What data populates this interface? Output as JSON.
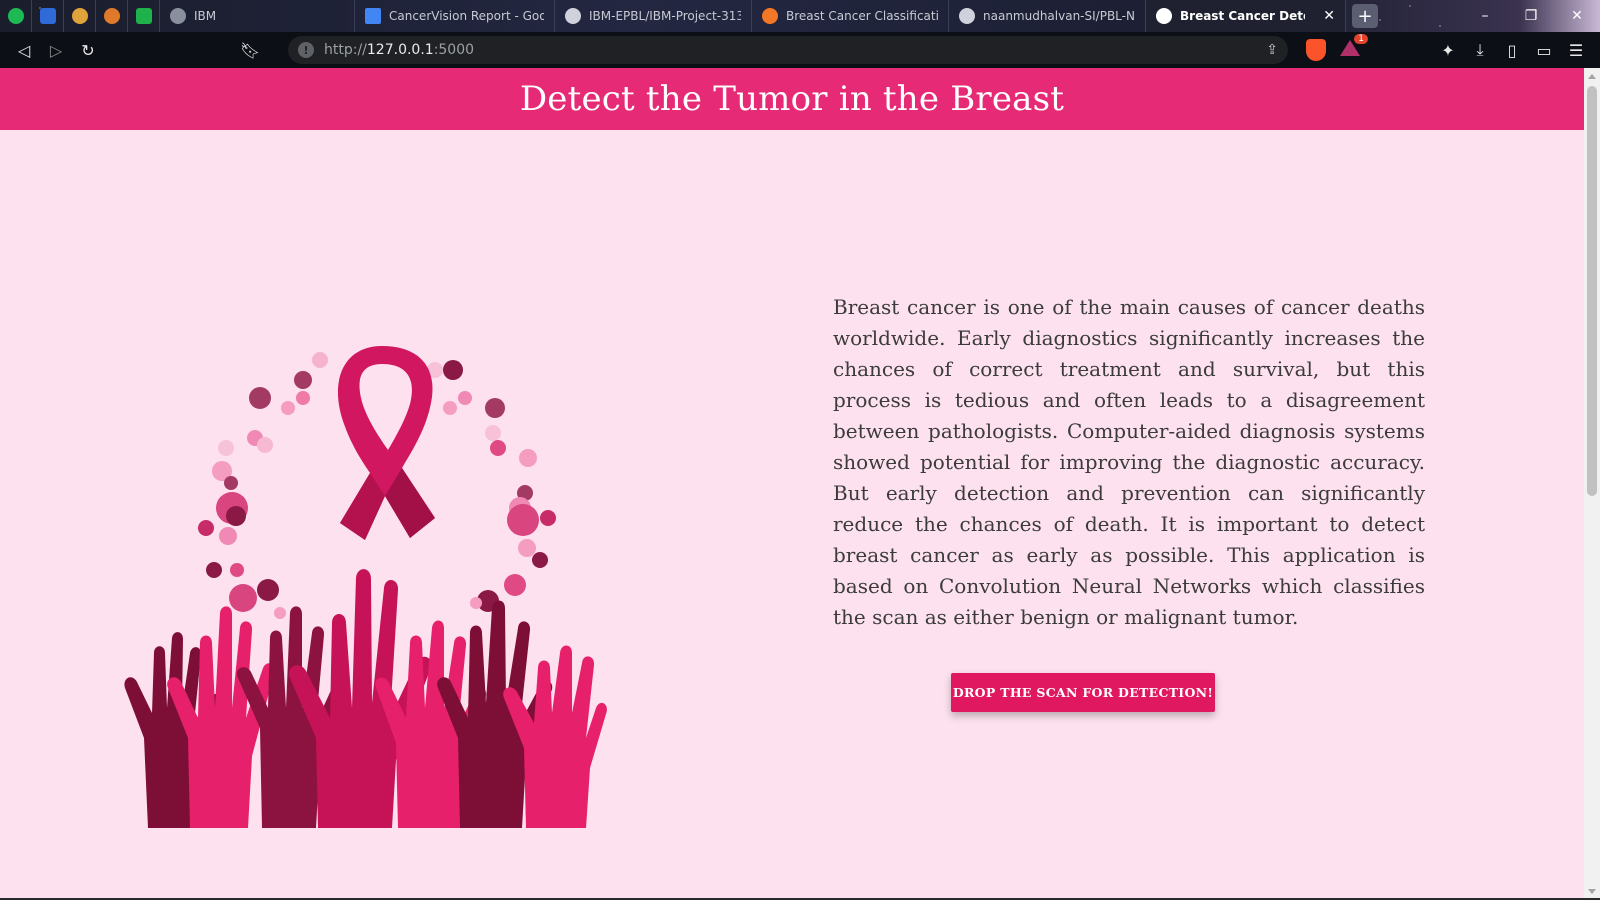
{
  "browser": {
    "pinned_tabs": [
      {
        "icon": "spotify-icon",
        "color": "#1db954"
      },
      {
        "icon": "bookmark-app-icon",
        "color": "#2e6ad8"
      },
      {
        "icon": "back-arrow-app-icon",
        "color": "#e0a23a"
      },
      {
        "icon": "swirl-app-icon",
        "color": "#e07a2a"
      },
      {
        "icon": "play-app-icon",
        "color": "#20b24a"
      }
    ],
    "tabs": [
      {
        "title": "IBM",
        "icon": "globe-icon",
        "icon_color": "#8a8f9e",
        "width": 195
      },
      {
        "title": "CancerVision Report - Goo...",
        "icon": "google-docs-icon",
        "icon_color": "#4285f4",
        "width": 200
      },
      {
        "title": "IBM-EPBL/IBM-Project-3133...",
        "icon": "github-icon",
        "icon_color": "#cfd2da",
        "width": 197
      },
      {
        "title": "Breast Cancer Classification...",
        "icon": "jupyter-icon",
        "icon_color": "#f37726",
        "width": 197
      },
      {
        "title": "naanmudhalvan-SI/PBL-NT-...",
        "icon": "github-icon",
        "icon_color": "#cfd2da",
        "width": 197
      },
      {
        "title": "Breast Cancer Detection",
        "icon": "globe-icon",
        "icon_color": "#ffffff",
        "width": 200,
        "active": true
      }
    ],
    "new_tab_label": "+",
    "address": {
      "scheme": "http://",
      "host": "127.0.0.1",
      "port": ":5000"
    },
    "rewards_badge": "1"
  },
  "page": {
    "title": "Detect the Tumor in the Breast",
    "description": "Breast cancer is one of the main causes of cancer deaths worldwide. Early diagnostics significantly increases the chances of correct treatment and survival, but this process is tedious and often leads to a disagreement between pathologists. Computer-aided diagnosis systems showed potential for improving the diagnostic accuracy. But early detection and prevention can significantly reduce the chances of death. It is important to detect breast cancer as early as possible. This application is based on Convolution Neural Networks which classifies the scan as either benign or malignant tumor.",
    "cta_label": "DROP THE SCAN FOR DETECTION!",
    "illustration_alt": "pink-ribbon-raised-hands-illustration",
    "colors": {
      "header": "#e62a75",
      "background": "#fde1ee",
      "button": "#e0185f",
      "ribbon": "#d01760",
      "hand_dark": "#7d0f36",
      "hand_mid": "#c61256",
      "hand_light": "#e6206a"
    }
  }
}
